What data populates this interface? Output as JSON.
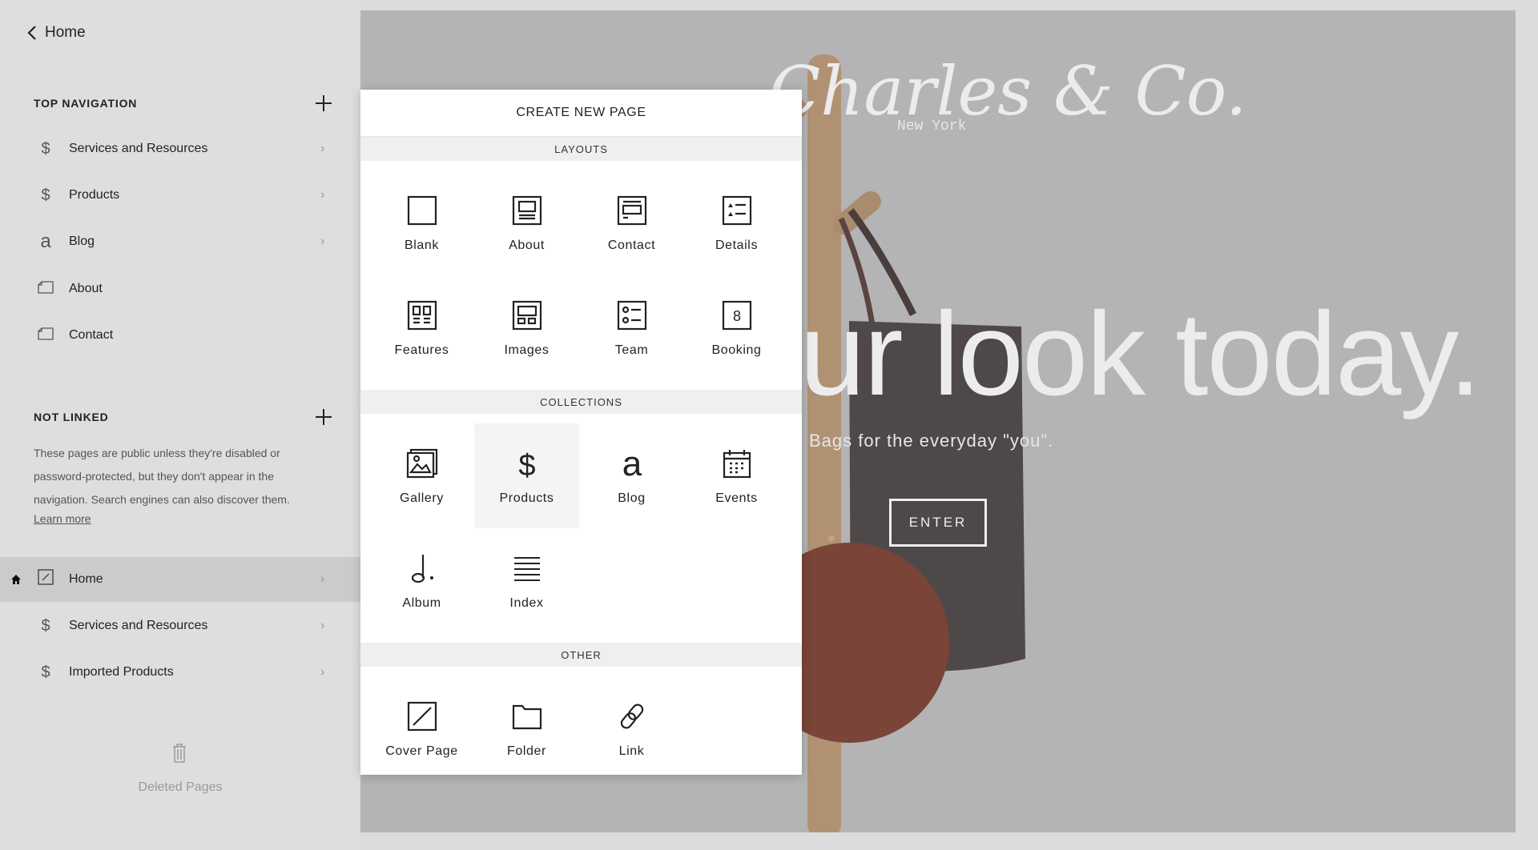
{
  "sidebar": {
    "back_label": "Home",
    "top_nav": {
      "title": "TOP NAVIGATION",
      "items": [
        {
          "label": "Services and Resources",
          "icon": "dollar-icon",
          "chevron": true
        },
        {
          "label": "Products",
          "icon": "dollar-icon",
          "chevron": true
        },
        {
          "label": "Blog",
          "icon": "blog-a-icon",
          "chevron": true
        },
        {
          "label": "About",
          "icon": "page-icon",
          "chevron": false
        },
        {
          "label": "Contact",
          "icon": "page-icon",
          "chevron": false
        }
      ]
    },
    "not_linked": {
      "title": "NOT LINKED",
      "description": "These pages are public unless they're disabled or password-protected, but they don't appear in the navigation. Search engines can also discover them.",
      "learn_more": "Learn more",
      "items": [
        {
          "label": "Home",
          "icon": "cover-page-icon",
          "selected": true,
          "is_homepage": true
        },
        {
          "label": "Services and Resources",
          "icon": "dollar-icon"
        },
        {
          "label": "Imported Products",
          "icon": "dollar-icon"
        }
      ]
    },
    "deleted_pages": "Deleted Pages"
  },
  "preview": {
    "logo": "Charles & Co.",
    "logo_sub": "New York",
    "headline": "ur look today.",
    "subheadline": "Bags for the everyday \"you\".",
    "button": "ENTER"
  },
  "modal": {
    "title": "CREATE NEW PAGE",
    "sections": [
      {
        "title": "LAYOUTS",
        "items": [
          {
            "label": "Blank",
            "icon": "blank"
          },
          {
            "label": "About",
            "icon": "about"
          },
          {
            "label": "Contact",
            "icon": "contact"
          },
          {
            "label": "Details",
            "icon": "details"
          },
          {
            "label": "Features",
            "icon": "features"
          },
          {
            "label": "Images",
            "icon": "images"
          },
          {
            "label": "Team",
            "icon": "team"
          },
          {
            "label": "Booking",
            "icon": "booking"
          }
        ]
      },
      {
        "title": "COLLECTIONS",
        "items": [
          {
            "label": "Gallery",
            "icon": "gallery"
          },
          {
            "label": "Products",
            "icon": "products",
            "hovered": true
          },
          {
            "label": "Blog",
            "icon": "blog"
          },
          {
            "label": "Events",
            "icon": "events"
          },
          {
            "label": "Album",
            "icon": "album"
          },
          {
            "label": "Index",
            "icon": "index"
          }
        ]
      },
      {
        "title": "OTHER",
        "items": [
          {
            "label": "Cover Page",
            "icon": "cover"
          },
          {
            "label": "Folder",
            "icon": "folder"
          },
          {
            "label": "Link",
            "icon": "link"
          }
        ]
      }
    ]
  }
}
